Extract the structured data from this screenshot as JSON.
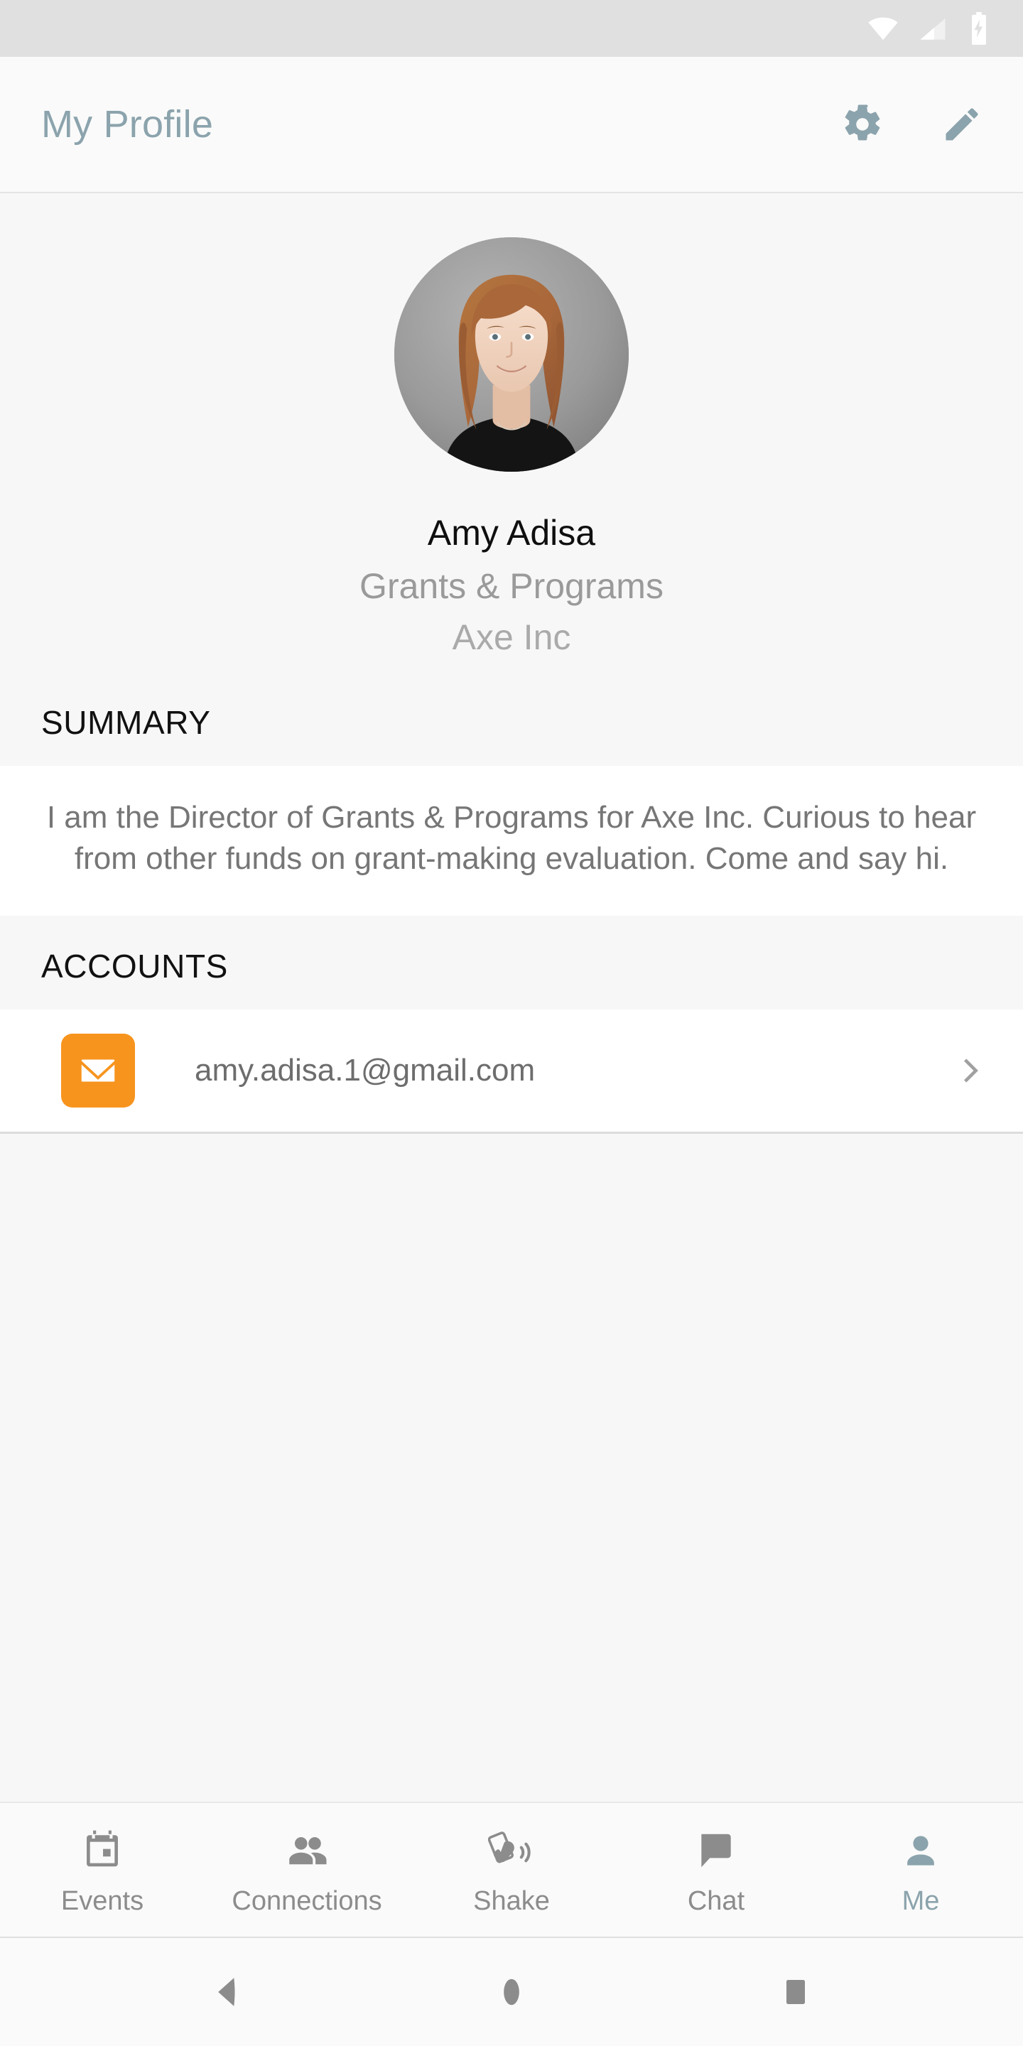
{
  "status_bar": {
    "icons": [
      "wifi-icon",
      "cellular-signal-icon",
      "battery-charging-icon"
    ],
    "icon_color": "#ffffff",
    "background": "#e0e0e0"
  },
  "app_bar": {
    "title": "My Profile",
    "title_color": "#8ba3ac",
    "actions": [
      {
        "name": "settings-button",
        "icon": "gear-icon"
      },
      {
        "name": "edit-button",
        "icon": "pencil-icon"
      }
    ]
  },
  "profile": {
    "avatar_alt": "profile-photo",
    "name": "Amy Adisa",
    "role": "Grants & Programs",
    "organization": "Axe Inc"
  },
  "summary": {
    "header": "SUMMARY",
    "text": "I am the Director of Grants & Programs for Axe Inc. Curious to hear from other funds on grant-making evaluation. Come and say hi."
  },
  "accounts": {
    "header": "ACCOUNTS",
    "items": [
      {
        "icon": "email-envelope-icon",
        "icon_color": "#f7941e",
        "label": "amy.adisa.1@gmail.com",
        "chevron": "chevron-right-icon"
      }
    ]
  },
  "bottom_nav": {
    "active_color": "#8ba3ac",
    "inactive_color": "#8c8c8c",
    "tabs": [
      {
        "label": "Events",
        "icon": "calendar-icon",
        "active": false
      },
      {
        "label": "Connections",
        "icon": "people-icon",
        "active": false
      },
      {
        "label": "Shake",
        "icon": "shake-phone-icon",
        "active": false
      },
      {
        "label": "Chat",
        "icon": "speech-bubble-icon",
        "active": false
      },
      {
        "label": "Me",
        "icon": "person-icon",
        "active": true
      }
    ]
  },
  "system_nav": {
    "buttons": [
      {
        "name": "back-button",
        "icon": "back-triangle-icon"
      },
      {
        "name": "home-button",
        "icon": "home-circle-icon"
      },
      {
        "name": "recents-button",
        "icon": "recents-square-icon"
      }
    ]
  }
}
